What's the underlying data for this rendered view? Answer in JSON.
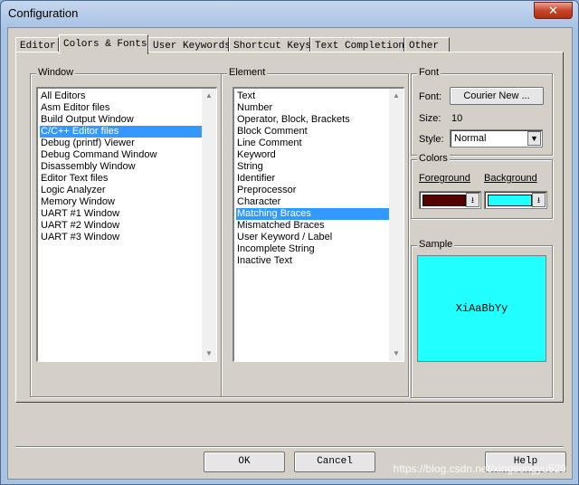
{
  "window": {
    "title": "Configuration",
    "close_glyph": "✕"
  },
  "tabs": [
    {
      "label": "Editor"
    },
    {
      "label": "Colors & Fonts"
    },
    {
      "label": "User Keywords"
    },
    {
      "label": "Shortcut Keys"
    },
    {
      "label": "Text Completion"
    },
    {
      "label": "Other"
    }
  ],
  "window_group": {
    "label": "Window",
    "items": [
      "All Editors",
      "Asm Editor files",
      "Build Output Window",
      "C/C++ Editor files",
      "Debug (printf) Viewer",
      "Debug Command Window",
      "Disassembly Window",
      "Editor Text files",
      "Logic Analyzer",
      "Memory Window",
      "UART #1 Window",
      "UART #2 Window",
      "UART #3 Window"
    ],
    "selected": "C/C++ Editor files"
  },
  "element_group": {
    "label": "Element",
    "items": [
      "Text",
      "Number",
      "Operator, Block, Brackets",
      "Block Comment",
      "Line Comment",
      "Keyword",
      "String",
      "Identifier",
      "Preprocessor",
      "Character",
      "Matching Braces",
      "Mismatched Braces",
      "User Keyword / Label",
      "Incomplete String",
      "Inactive Text"
    ],
    "selected": "Matching Braces"
  },
  "font_group": {
    "label": "Font",
    "font_label": "Font:",
    "font_button": "Courier New ...",
    "size_label": "Size:",
    "size_value": "10",
    "style_label": "Style:",
    "style_value": "Normal"
  },
  "colors_group": {
    "label": "Colors",
    "foreground_label": "Foreground",
    "background_label": "Background",
    "foreground_color": "#550000",
    "background_color": "#22ffff"
  },
  "sample_group": {
    "label": "Sample",
    "text": "XiAaBbYy",
    "background": "#22ffff"
  },
  "buttons": {
    "ok": "OK",
    "cancel": "Cancel",
    "help": "Help"
  },
  "watermark": "https://blog.csdn.net/xingsongyu520"
}
